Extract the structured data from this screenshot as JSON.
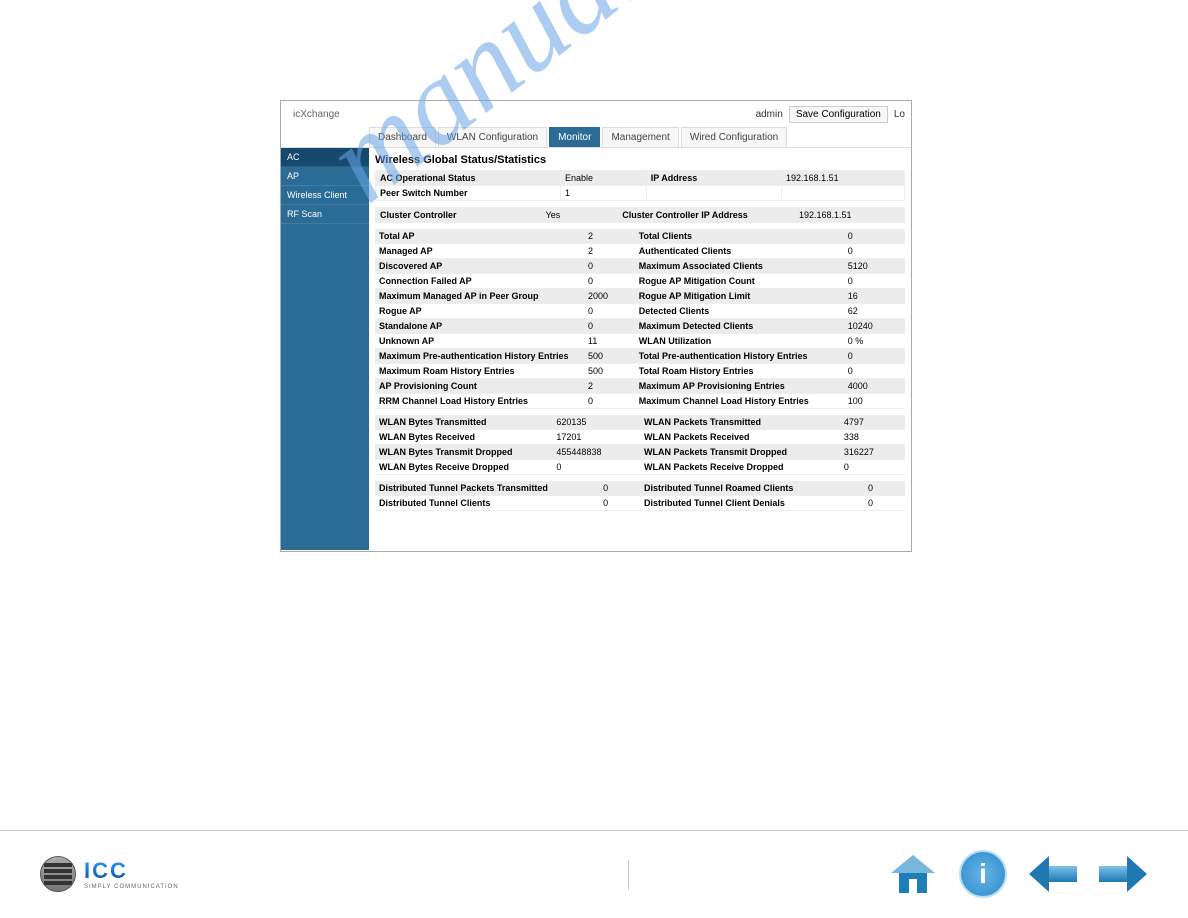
{
  "watermark": "manualshive.com",
  "header": {
    "brand": "icXchange",
    "user": "admin",
    "save": "Save Configuration",
    "extra": "Lo"
  },
  "tabs": [
    "Dashboard",
    "WLAN Configuration",
    "Monitor",
    "Management",
    "Wired Configuration"
  ],
  "tabs_active_index": 2,
  "sidebar": {
    "items": [
      "AC",
      "AP",
      "Wireless Client",
      "RF Scan"
    ],
    "active_index": 0
  },
  "content": {
    "title": "Wireless Global Status/Statistics",
    "status_top": [
      {
        "label": "AC Operational Status",
        "value": "Enable",
        "label2": "IP Address",
        "value2": "192.168.1.51"
      },
      {
        "label": "Peer Switch Number",
        "value": "1",
        "label2": "",
        "value2": ""
      }
    ],
    "cluster": [
      {
        "label": "Cluster Controller",
        "value": "Yes",
        "label2": "Cluster Controller IP Address",
        "value2": "192.168.1.51"
      }
    ],
    "stats_rows": [
      {
        "l": "Total AP",
        "v": "2",
        "l2": "Total Clients",
        "v2": "0"
      },
      {
        "l": "Managed AP",
        "v": "2",
        "l2": "Authenticated Clients",
        "v2": "0"
      },
      {
        "l": "Discovered AP",
        "v": "0",
        "l2": "Maximum Associated Clients",
        "v2": "5120"
      },
      {
        "l": "Connection Failed AP",
        "v": "0",
        "l2": "Rogue AP Mitigation Count",
        "v2": "0"
      },
      {
        "l": "Maximum Managed AP in Peer Group",
        "v": "2000",
        "l2": "Rogue AP Mitigation Limit",
        "v2": "16"
      },
      {
        "l": "Rogue AP",
        "v": "0",
        "l2": "Detected Clients",
        "v2": "62"
      },
      {
        "l": "Standalone AP",
        "v": "0",
        "l2": "Maximum Detected Clients",
        "v2": "10240"
      },
      {
        "l": "Unknown AP",
        "v": "11",
        "l2": "WLAN Utilization",
        "v2": "0 %"
      },
      {
        "l": "Maximum Pre-authentication History Entries",
        "v": "500",
        "l2": "Total Pre-authentication History Entries",
        "v2": "0"
      },
      {
        "l": "Maximum Roam History Entries",
        "v": "500",
        "l2": "Total Roam History Entries",
        "v2": "0"
      },
      {
        "l": "AP Provisioning Count",
        "v": "2",
        "l2": "Maximum AP Provisioning Entries",
        "v2": "4000"
      },
      {
        "l": "RRM Channel Load History Entries",
        "v": "0",
        "l2": "Maximum Channel Load History Entries",
        "v2": "100"
      }
    ],
    "wlan_rows": [
      {
        "l": "WLAN Bytes Transmitted",
        "v": "620135",
        "l2": "WLAN Packets Transmitted",
        "v2": "4797"
      },
      {
        "l": "WLAN Bytes Received",
        "v": "17201",
        "l2": "WLAN Packets Received",
        "v2": "338"
      },
      {
        "l": "WLAN Bytes Transmit Dropped",
        "v": "455448838",
        "l2": "WLAN Packets Transmit Dropped",
        "v2": "316227"
      },
      {
        "l": "WLAN Bytes Receive Dropped",
        "v": "0",
        "l2": "WLAN Packets Receive Dropped",
        "v2": "0"
      }
    ],
    "tunnel_rows": [
      {
        "l": "Distributed Tunnel Packets Transmitted",
        "v": "0",
        "l2": "Distributed Tunnel Roamed Clients",
        "v2": "0"
      },
      {
        "l": "Distributed Tunnel Clients",
        "v": "0",
        "l2": "Distributed Tunnel Client Denials",
        "v2": "0"
      }
    ]
  },
  "footer": {
    "logo_main": "ICC",
    "logo_sub": "SIMPLY COMMUNICATION"
  }
}
